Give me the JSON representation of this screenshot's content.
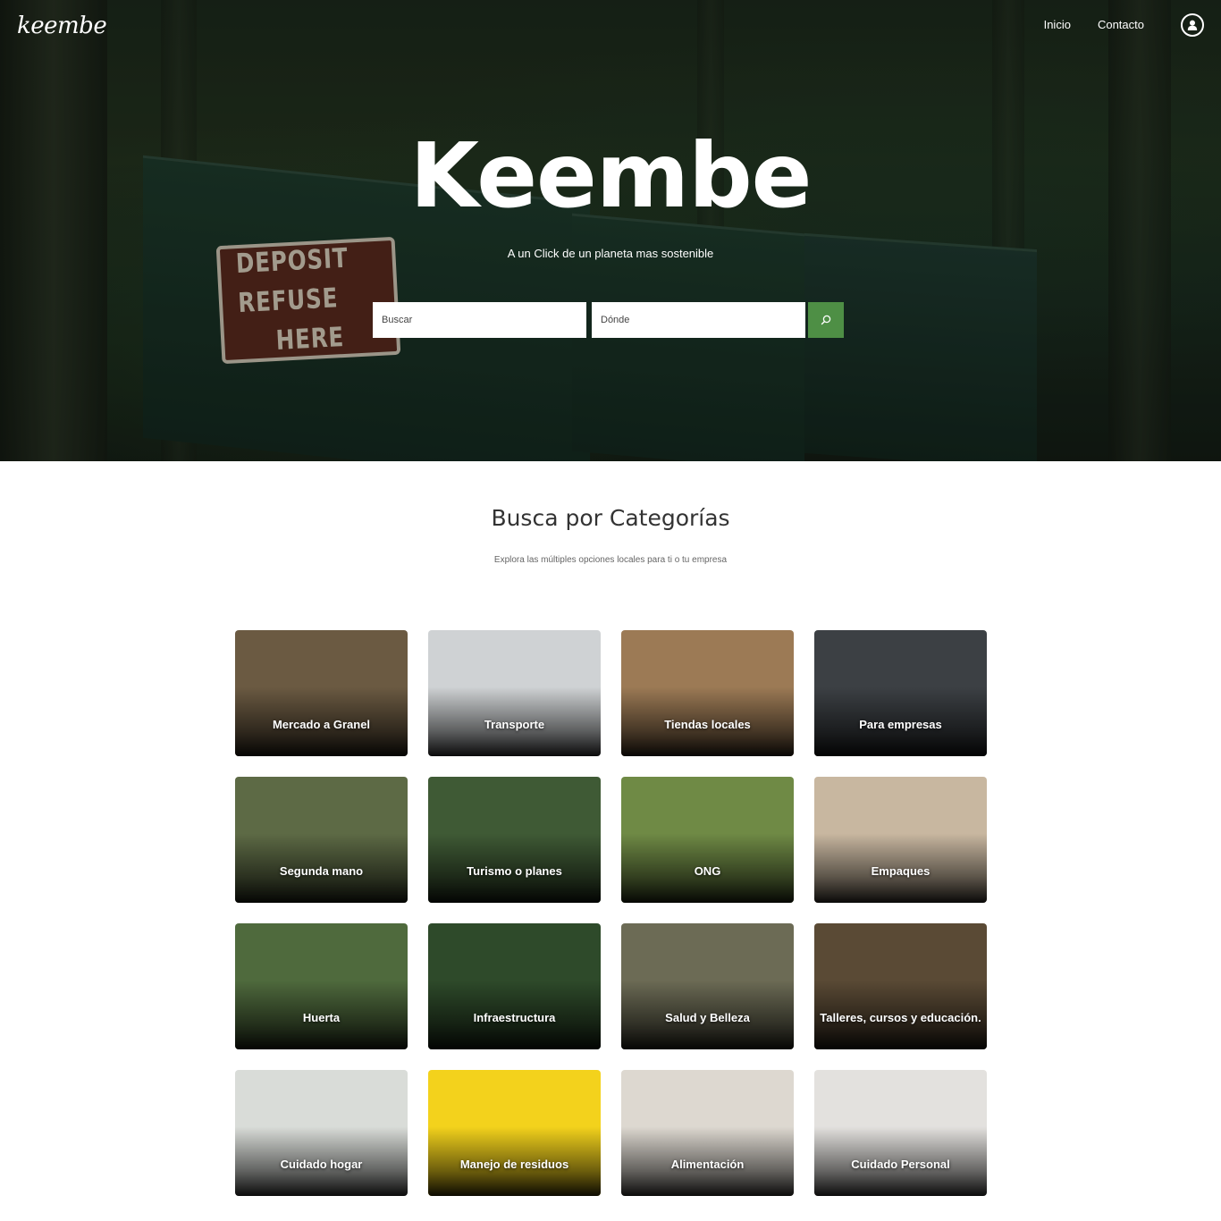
{
  "nav": {
    "logo": "keembe",
    "links": [
      "Inicio",
      "Contacto"
    ],
    "user_icon": "user-circle-icon"
  },
  "hero": {
    "title": "Keembe",
    "subtitle": "A un Click de un planeta mas sostenible",
    "sign_line1": "DEPOSIT REFUSE",
    "sign_line2": "HERE",
    "search_placeholder": "Buscar",
    "where_placeholder": "Dónde",
    "search_button_icon": "search-icon",
    "accent_color": "#4e8f45"
  },
  "section": {
    "title": "Busca por Categorías",
    "subtitle": "Explora las múltiples opciones locales para ti o tu empresa"
  },
  "categories": [
    {
      "label": "Mercado a Granel",
      "color": "#6b5a42"
    },
    {
      "label": "Transporte",
      "color": "#cfd2d4"
    },
    {
      "label": "Tiendas locales",
      "color": "#9c7a55"
    },
    {
      "label": "Para empresas",
      "color": "#3c4044"
    },
    {
      "label": "Segunda mano",
      "color": "#5d6a45"
    },
    {
      "label": "Turismo o planes",
      "color": "#3f5a35"
    },
    {
      "label": "ONG",
      "color": "#6f8a45"
    },
    {
      "label": "Empaques",
      "color": "#c8b7a0"
    },
    {
      "label": "Huerta",
      "color": "#4f6a3d"
    },
    {
      "label": "Infraestructura",
      "color": "#2e4a2a"
    },
    {
      "label": "Salud y Belleza",
      "color": "#6c6b55"
    },
    {
      "label": "Talleres, cursos y educación.",
      "color": "#5a4a35"
    },
    {
      "label": "Cuidado hogar",
      "color": "#d9dcd8"
    },
    {
      "label": "Manejo de residuos",
      "color": "#f3d21c"
    },
    {
      "label": "Alimentación",
      "color": "#ddd8d0"
    },
    {
      "label": "Cuidado Personal",
      "color": "#e3e1de"
    }
  ]
}
